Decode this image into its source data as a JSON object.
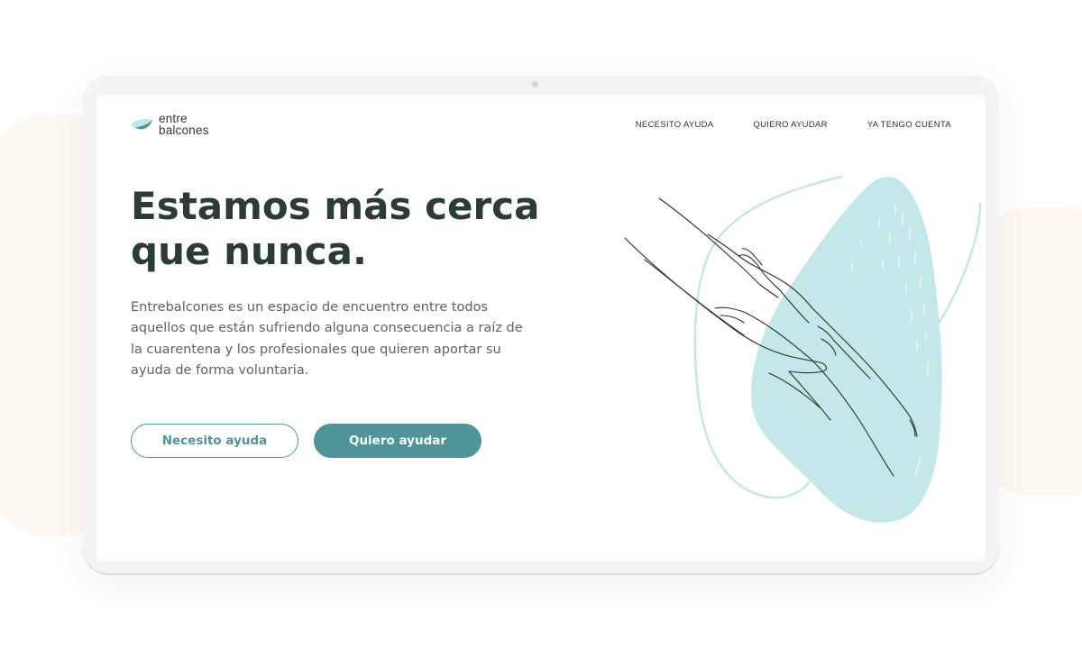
{
  "brand": {
    "name_line1": "entre",
    "name_line2": "balcones",
    "accent_color": "#4e9499",
    "blob_color": "#c3e8e7",
    "heading_color": "#2c3a38"
  },
  "nav": {
    "items": [
      {
        "label": "NECESITO AYUDA"
      },
      {
        "label": "QUIERO AYUDAR"
      },
      {
        "label": "YA TENGO CUENTA"
      }
    ]
  },
  "hero": {
    "title_line1": "Estamos más cerca",
    "title_line2": "que nunca.",
    "description": "Entrebalcones es un espacio de encuentro entre todos aquellos que están sufriendo alguna consecuencia a raíz de la cuarentena y los profesionales que quieren aportar su ayuda de forma voluntaria.",
    "primary_button": "Quiero ayudar",
    "secondary_button": "Necesito ayuda"
  },
  "illustration": {
    "icon": "hands-touching-illustration"
  }
}
